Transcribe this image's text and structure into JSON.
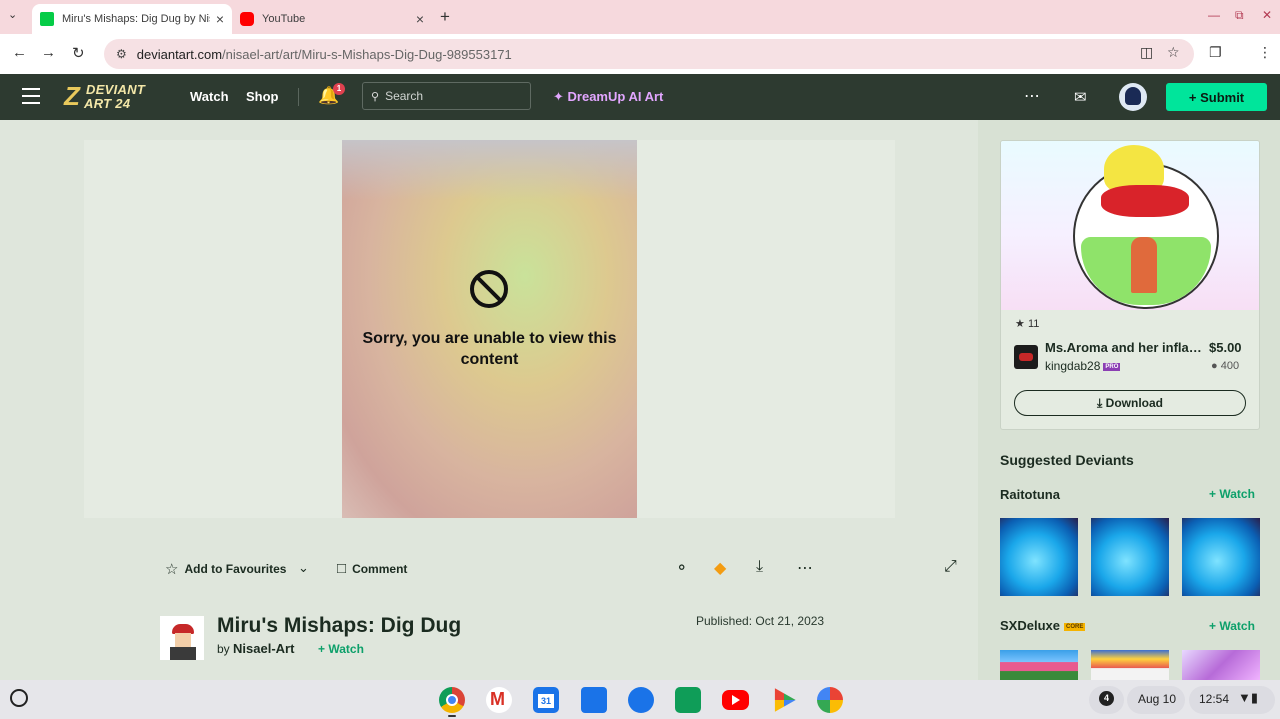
{
  "browser": {
    "tabs": [
      {
        "title": "Miru's Mishaps: Dig Dug by Nis",
        "active": true,
        "favicon": "deviantart-icon"
      },
      {
        "title": "YouTube",
        "active": false,
        "favicon": "youtube-icon"
      }
    ],
    "new_tab_icon": "+",
    "url_domain": "deviantart.com",
    "url_path": "/nisael-art/art/Miru-s-Mishaps-Dig-Dug-989553171"
  },
  "header": {
    "logo_line1": "DEVIANT",
    "logo_line2": "ART 24",
    "nav": [
      "Watch",
      "Shop"
    ],
    "notification_count": "1",
    "search_placeholder": "Search",
    "dreamup_label": "DreamUp AI Art",
    "submit_label": "Submit",
    "colors": {
      "header_bg": "#2d3a30",
      "submit_bg": "#00e59b",
      "dreamup": "#e2a6ff"
    }
  },
  "deviation": {
    "blocked_message": "Sorry, you are unable to view this content",
    "add_fav_label": "Add to Favourites",
    "comment_label": "Comment",
    "title": "Miru's Mishaps: Dig Dug",
    "by_label": "by",
    "author": "Nisael-Art",
    "watch_label": "Watch",
    "published": "Published: Oct 21, 2023"
  },
  "sidebar": {
    "shop_item": {
      "favourites": "11",
      "title": "Ms.Aroma and her inflated",
      "price": "$5.00",
      "seller": "kingdab28",
      "seller_badge": "PRO",
      "points": "400",
      "download_label": "Download"
    },
    "suggested_title": "Suggested Deviants",
    "deviants": [
      {
        "name": "Raitotuna",
        "badge": "",
        "watch_label": "Watch"
      },
      {
        "name": "SXDeluxe",
        "badge": "CORE",
        "watch_label": "Watch"
      }
    ]
  },
  "shelf": {
    "notification_count": "4",
    "date": "Aug 10",
    "time": "12:54"
  }
}
